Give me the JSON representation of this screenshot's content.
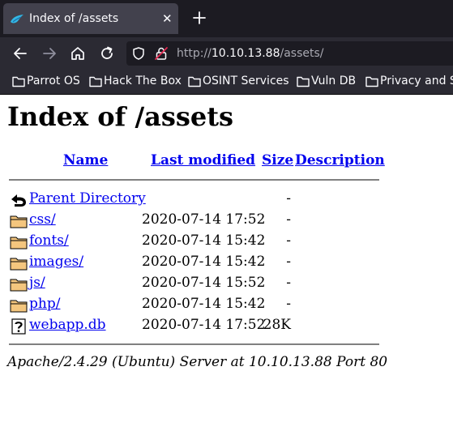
{
  "browser": {
    "tab": {
      "title": "Index of /assets",
      "close_glyph": "✕",
      "favicon": "parrot-icon"
    },
    "new_tab_icon": "plus-icon",
    "nav_icons": [
      "back-arrow-icon",
      "forward-arrow-icon",
      "home-icon",
      "reload-icon"
    ],
    "url": {
      "scheme": "http://",
      "host": "10.10.13.88",
      "path": "/assets/"
    },
    "bookmarks": [
      {
        "label": "Parrot OS"
      },
      {
        "label": "Hack The Box"
      },
      {
        "label": "OSINT Services"
      },
      {
        "label": "Vuln DB"
      },
      {
        "label": "Privacy and Security"
      }
    ],
    "colors": {
      "tabbar": "#1c1b22",
      "toolbar": "#2b2a33",
      "text": "#fbfbfe"
    }
  },
  "page": {
    "heading": "Index of /assets",
    "columns": {
      "name": "Name",
      "modified": "Last modified",
      "size": "Size",
      "description": "Description"
    },
    "rows": [
      {
        "icon": "parent-directory-icon",
        "name": "Parent Directory",
        "modified": "",
        "size": "-"
      },
      {
        "icon": "folder-icon",
        "name": "css/",
        "modified": "2020-07-14 17:52",
        "size": "-"
      },
      {
        "icon": "folder-icon",
        "name": "fonts/",
        "modified": "2020-07-14 15:42",
        "size": "-"
      },
      {
        "icon": "folder-icon",
        "name": "images/",
        "modified": "2020-07-14 15:42",
        "size": "-"
      },
      {
        "icon": "folder-icon",
        "name": "js/",
        "modified": "2020-07-14 15:52",
        "size": "-"
      },
      {
        "icon": "folder-icon",
        "name": "php/",
        "modified": "2020-07-14 15:42",
        "size": "-"
      },
      {
        "icon": "unknown-file-icon",
        "name": "webapp.db",
        "modified": "2020-07-14 17:52",
        "size": "28K"
      }
    ],
    "address": "Apache/2.4.29 (Ubuntu) Server at 10.10.13.88 Port 80",
    "link_color": "#0000ee"
  }
}
